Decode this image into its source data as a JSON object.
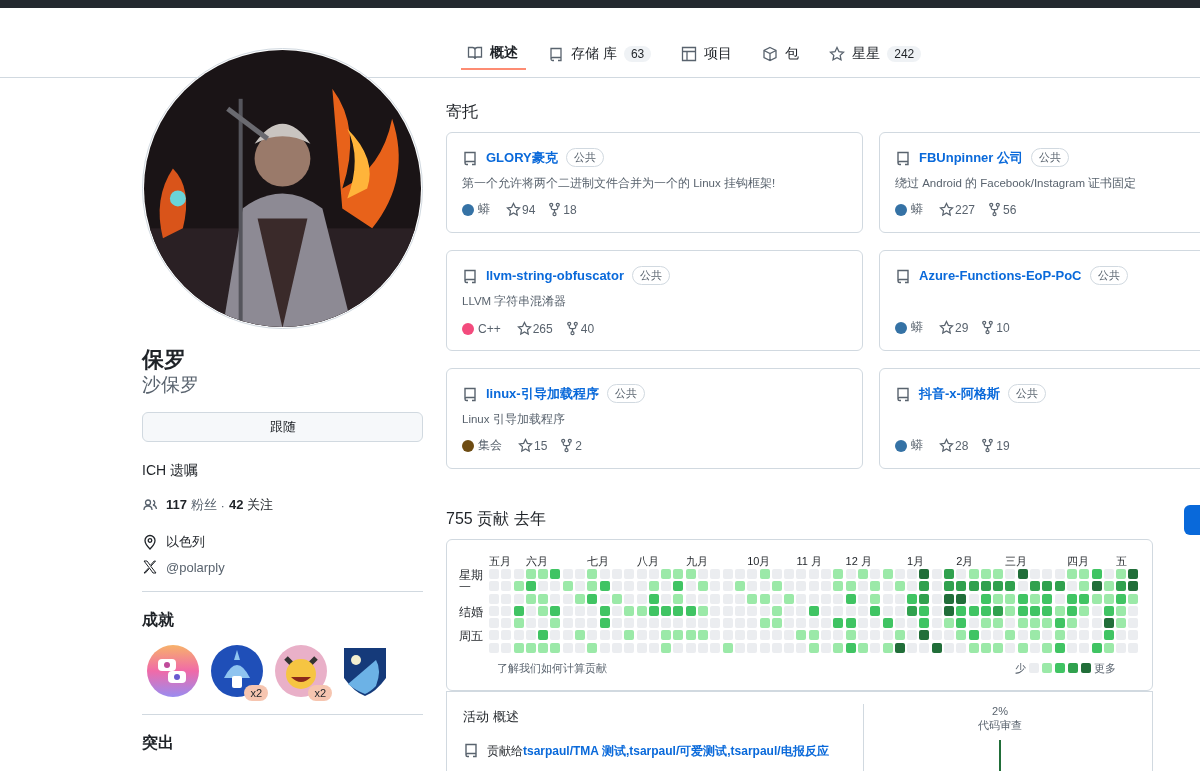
{
  "tabs": [
    {
      "label": "概述",
      "selected": true
    },
    {
      "label": "存储 库",
      "count": "63",
      "selected": false
    },
    {
      "label": "项目",
      "selected": false
    },
    {
      "label": "包",
      "selected": false
    },
    {
      "label": "星星",
      "count": "242",
      "selected": false
    }
  ],
  "profile": {
    "name": "保罗",
    "login": "沙保罗",
    "follow_button": "跟随",
    "bio": "ICH 遗嘱",
    "followers": "117",
    "followers_label": "粉丝",
    "separator": "·",
    "following": "42",
    "following_label": "关注",
    "location": "以色列",
    "social": "@polarply"
  },
  "achievements": {
    "title": "成就",
    "badges": [
      {
        "kind": "yolo"
      },
      {
        "kind": "shark",
        "count": "x2"
      },
      {
        "kind": "star-eyes",
        "count": "x2"
      },
      {
        "kind": "shield"
      }
    ]
  },
  "highlights": {
    "title": "突出"
  },
  "pinned": {
    "title": "寄托",
    "repos": [
      {
        "name": "GLORY豪克",
        "visibility": "公共",
        "description": "第一个允许将两个二进制文件合并为一个的 Linux 挂钩框架!",
        "language": "蟒",
        "color": "#3572a5",
        "stars": "94",
        "forks": "18"
      },
      {
        "name": "FBUnpinner 公司",
        "visibility": "公共",
        "description": "绕过 Android 的 Facebook/Instagram 证书固定",
        "language": "蟒",
        "color": "#3572a5",
        "stars": "227",
        "forks": "56"
      },
      {
        "name": "llvm-string-obfuscator",
        "visibility": "公共",
        "description": "LLVM 字符串混淆器",
        "language": "C++",
        "color": "#f34b7d",
        "stars": "265",
        "forks": "40"
      },
      {
        "name": "Azure-Functions-EoP-PoC",
        "visibility": "公共",
        "language": "蟒",
        "color": "#3572a5",
        "stars": "29",
        "forks": "10"
      },
      {
        "name": "linux-引导加载程序",
        "visibility": "公共",
        "description": "Linux 引导加载程序",
        "language": "集会",
        "color": "#6e4c13",
        "stars": "15",
        "forks": "2"
      },
      {
        "name": "抖音-x-阿格斯",
        "visibility": "公共",
        "language": "蟒",
        "color": "#3572a5",
        "stars": "28",
        "forks": "19"
      }
    ]
  },
  "contributions": {
    "title": "755 贡献 去年",
    "months": [
      "五月",
      "六月",
      "七月",
      "八月",
      "九月",
      "10月",
      "11 月",
      "12 月",
      "1月",
      "2月",
      "三月",
      "四月",
      "五"
    ],
    "days": [
      "星期一",
      "结婚",
      "周五"
    ],
    "footnote": "了解我们如何计算贡献",
    "legend_less": "少",
    "legend_more": "更多"
  },
  "activity": {
    "title": "活动 概述",
    "prefix": "贡献给",
    "separator": ",",
    "repos": [
      "tsarpaul/TMA 测试",
      "tsarpaul/可爱测试",
      "tsarpaul/电报反应"
    ],
    "review_percent": "2%",
    "review_label": "代码审查"
  }
}
